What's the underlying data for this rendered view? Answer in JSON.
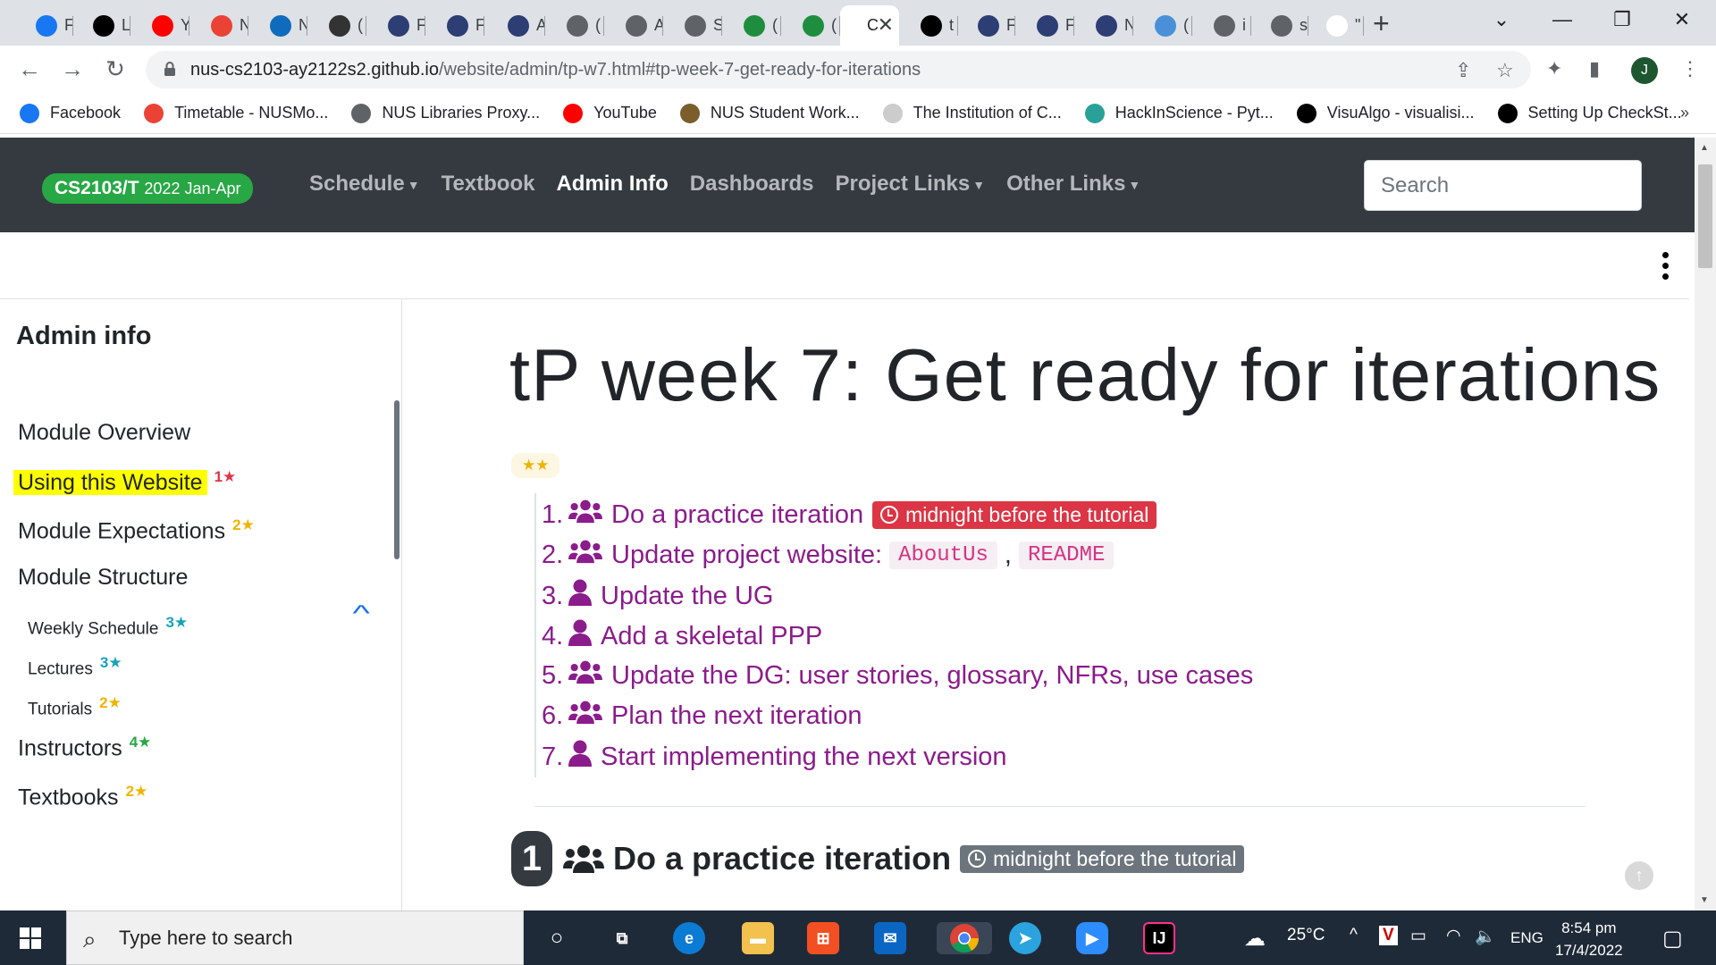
{
  "browser": {
    "tabs": [
      {
        "label": "F",
        "icon": "facebook-icon",
        "color": "#1877f2"
      },
      {
        "label": "L",
        "icon": "visualgo-icon",
        "color": "#000000"
      },
      {
        "label": "Y",
        "icon": "youtube-icon",
        "color": "#ff0000"
      },
      {
        "label": "N",
        "icon": "m-icon",
        "color": "#ea4335"
      },
      {
        "label": "N",
        "icon": "outlook-icon",
        "color": "#0f6cbd"
      },
      {
        "label": "(",
        "icon": "q-icon",
        "color": "#333333"
      },
      {
        "label": "F",
        "icon": "pattern-icon",
        "color": "#2c3e73"
      },
      {
        "label": "F",
        "icon": "pattern-icon",
        "color": "#2c3e73"
      },
      {
        "label": "A",
        "icon": "pattern-icon",
        "color": "#2c3e73"
      },
      {
        "label": "(",
        "icon": "globe-icon",
        "color": "#5f6368"
      },
      {
        "label": "A",
        "icon": "globe-icon",
        "color": "#5f6368"
      },
      {
        "label": "S",
        "icon": "globe-icon",
        "color": "#5f6368"
      },
      {
        "label": "(",
        "icon": "graduation-cap-icon",
        "color": "#1e8e3e"
      },
      {
        "label": "(",
        "icon": "graduation-cap-icon",
        "color": "#1e8e3e"
      },
      {
        "label": "C",
        "icon": "active-tab",
        "color": "#ffffff",
        "active": true
      },
      {
        "label": "t",
        "icon": "github-icon",
        "color": "#000000"
      },
      {
        "label": "F",
        "icon": "pattern-icon",
        "color": "#2c3e73"
      },
      {
        "label": "F",
        "icon": "pattern-icon",
        "color": "#2c3e73"
      },
      {
        "label": "N",
        "icon": "pattern-icon",
        "color": "#2c3e73"
      },
      {
        "label": "(",
        "icon": "bank-icon",
        "color": "#4a90d9"
      },
      {
        "label": "i",
        "icon": "globe-icon",
        "color": "#5f6368"
      },
      {
        "label": "s",
        "icon": "globe-icon",
        "color": "#5f6368"
      },
      {
        "label": "\"",
        "icon": "google-icon",
        "color": "#ffffff"
      }
    ],
    "url_host": "nus-cs2103-ay2122s2.github.io",
    "url_path": "/website/admin/tp-w7.html#tp-week-7-get-ready-for-iterations",
    "profile_initial": "J",
    "bookmarks": [
      {
        "label": "Facebook",
        "icon": "facebook-icon",
        "color": "#1877f2"
      },
      {
        "label": "Timetable - NUSMo...",
        "icon": "nusmods-icon",
        "color": "#ea4335"
      },
      {
        "label": "NUS Libraries Proxy...",
        "icon": "globe-icon",
        "color": "#5f6368"
      },
      {
        "label": "YouTube",
        "icon": "youtube-icon",
        "color": "#ff0000"
      },
      {
        "label": "NUS Student Work...",
        "icon": "crest-icon",
        "color": "#7b5e2c"
      },
      {
        "label": "The Institution of C...",
        "icon": "ice-icon",
        "color": "#cccccc"
      },
      {
        "label": "HackInScience - Pyt...",
        "icon": "hackinscience-icon",
        "color": "#2aa198"
      },
      {
        "label": "VisuAlgo - visualisi...",
        "icon": "visualgo-icon",
        "color": "#000000"
      },
      {
        "label": "Setting Up CheckSt...",
        "icon": "github-icon",
        "color": "#000000"
      }
    ],
    "bookmarks_overflow": "»"
  },
  "site": {
    "brand_main": "CS2103/T",
    "brand_sub": "2022 Jan-Apr",
    "nav": [
      {
        "label": "Schedule",
        "dropdown": true,
        "active": false
      },
      {
        "label": "Textbook",
        "dropdown": false,
        "active": false
      },
      {
        "label": "Admin Info",
        "dropdown": false,
        "active": true
      },
      {
        "label": "Dashboards",
        "dropdown": false,
        "active": false
      },
      {
        "label": "Project Links",
        "dropdown": true,
        "active": false
      },
      {
        "label": "Other Links",
        "dropdown": true,
        "active": false
      }
    ],
    "search_placeholder": "Search"
  },
  "sidebar": {
    "title": "Admin info",
    "items": [
      {
        "label": "Module Overview",
        "stars": "",
        "star_color": ""
      },
      {
        "label": "Using this Website",
        "stars": "1",
        "star_color": "#dc3545",
        "highlight": true
      },
      {
        "label": "Module Expectations",
        "stars": "2",
        "star_color": "#f0b400"
      },
      {
        "label": "Module Structure",
        "stars": "",
        "star_color": ""
      },
      {
        "label": "Weekly Schedule",
        "stars": "3",
        "star_color": "#17a2b8",
        "small": true
      },
      {
        "label": "Lectures",
        "stars": "3",
        "star_color": "#17a2b8",
        "small": true
      },
      {
        "label": "Tutorials",
        "stars": "2",
        "star_color": "#f0b400",
        "small": true
      },
      {
        "label": "Instructors",
        "stars": "4",
        "star_color": "#28a745"
      },
      {
        "label": "Textbooks",
        "stars": "2",
        "star_color": "#f0b400"
      }
    ]
  },
  "main": {
    "title": "tP week 7: Get ready for iterations",
    "rating": "★★",
    "toc": [
      {
        "num": "1.",
        "icon": "users-icon",
        "label": "Do a practice iteration",
        "deadline": "midnight before the tutorial"
      },
      {
        "num": "2.",
        "icon": "users-icon",
        "label": "Update project website:",
        "codes": [
          "AboutUs",
          "README"
        ]
      },
      {
        "num": "3.",
        "icon": "user-icon",
        "label": "Update the UG"
      },
      {
        "num": "4.",
        "icon": "user-icon",
        "label": "Add a skeletal PPP"
      },
      {
        "num": "5.",
        "icon": "users-icon",
        "label": "Update the DG: user stories, glossary, NFRs, use cases"
      },
      {
        "num": "6.",
        "icon": "users-icon",
        "label": "Plan the next iteration"
      },
      {
        "num": "7.",
        "icon": "user-icon",
        "label": "Start implementing the next version"
      }
    ],
    "code_separator": ",",
    "section": {
      "num": "1",
      "title": "Do a practice iteration",
      "deadline": "midnight before the tutorial"
    }
  },
  "taskbar": {
    "search_placeholder": "Type here to search",
    "weather": "25°C",
    "lang": "ENG",
    "time": "8:54 pm",
    "date": "17/4/2022"
  },
  "colors": {
    "navbar": "#343a40",
    "brand": "#28a745",
    "link": "#8b1c8b",
    "deadline": "#dc3545",
    "highlight": "#ffff00"
  }
}
